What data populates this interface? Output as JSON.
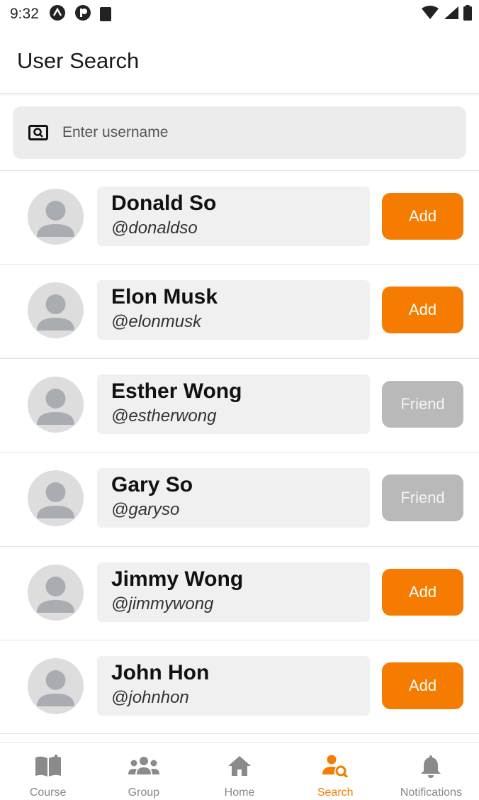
{
  "status_bar": {
    "time": "9:32"
  },
  "app_bar": {
    "title": "User Search"
  },
  "search": {
    "placeholder": "Enter username",
    "value": ""
  },
  "users": [
    {
      "name": "Donald So",
      "handle": "@donaldso",
      "action": "Add"
    },
    {
      "name": "Elon Musk",
      "handle": "@elonmusk",
      "action": "Add"
    },
    {
      "name": "Esther Wong",
      "handle": "@estherwong",
      "action": "Friend"
    },
    {
      "name": "Gary So",
      "handle": "@garyso",
      "action": "Friend"
    },
    {
      "name": "Jimmy Wong",
      "handle": "@jimmywong",
      "action": "Add"
    },
    {
      "name": "John Hon",
      "handle": "@johnhon",
      "action": "Add"
    }
  ],
  "nav": [
    {
      "label": "Course",
      "icon": "book-icon",
      "active": false
    },
    {
      "label": "Group",
      "icon": "group-icon",
      "active": false
    },
    {
      "label": "Home",
      "icon": "home-icon",
      "active": false
    },
    {
      "label": "Search",
      "icon": "person-search-icon",
      "active": true
    },
    {
      "label": "Notifications",
      "icon": "bell-icon",
      "active": false
    }
  ],
  "colors": {
    "accent": "#f57c00",
    "friend_button": "#b9b9b9",
    "card": "#f0f0f0"
  }
}
